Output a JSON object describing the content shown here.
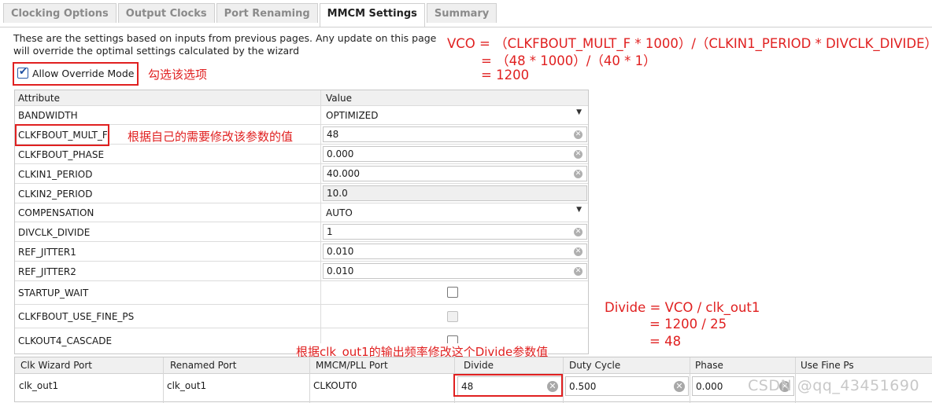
{
  "tabs": [
    "Clocking Options",
    "Output Clocks",
    "Port Renaming",
    "MMCM Settings",
    "Summary"
  ],
  "description": "These are the settings based on inputs from previous pages. Any update on this page will override the optimal settings calculated by the wizard",
  "override_label": "Allow Override Mode",
  "annot_override": "勾选该选项",
  "annot_mult": "根据自己的需要修改该参数的值",
  "annot_divide_hint": "根据clk_out1的输出频率修改这个Divide参数值",
  "vco_formula": [
    "VCO = （CLKFBOUT_MULT_F * 1000）/（CLKIN1_PERIOD * DIVCLK_DIVIDE）",
    "= （48 * 1000）/（40 * 1）",
    "= 1200"
  ],
  "divide_formula": [
    "Divide = VCO / clk_out1",
    "= 1200 / 25",
    "= 48"
  ],
  "attr_headers": [
    "Attribute",
    "Value"
  ],
  "attrs": [
    {
      "name": "BANDWIDTH",
      "value": "OPTIMIZED"
    },
    {
      "name": "CLKFBOUT_MULT_F",
      "value": "48"
    },
    {
      "name": "CLKFBOUT_PHASE",
      "value": "0.000"
    },
    {
      "name": "CLKIN1_PERIOD",
      "value": "40.000"
    },
    {
      "name": "CLKIN2_PERIOD",
      "value": "10.0"
    },
    {
      "name": "COMPENSATION",
      "value": "AUTO"
    },
    {
      "name": "DIVCLK_DIVIDE",
      "value": "1"
    },
    {
      "name": "REF_JITTER1",
      "value": "0.010"
    },
    {
      "name": "REF_JITTER2",
      "value": "0.010"
    },
    {
      "name": "STARTUP_WAIT",
      "value": ""
    },
    {
      "name": "CLKFBOUT_USE_FINE_PS",
      "value": ""
    },
    {
      "name": "CLKOUT4_CASCADE",
      "value": ""
    }
  ],
  "port_headers": [
    "Clk Wizard Port",
    "Renamed Port",
    "MMCM/PLL Port",
    "Divide",
    "Duty Cycle",
    "Phase",
    "Use Fine Ps"
  ],
  "port_row": {
    "wizard_port": "clk_out1",
    "renamed_port": "clk_out1",
    "mmcm_port": "CLKOUT0",
    "divide": "48",
    "duty": "0.500",
    "phase": "0.000"
  },
  "watermark": "CSDN @qq_43451690",
  "colors": {
    "annotation": "#e02020",
    "check": "#1e4fa0"
  }
}
